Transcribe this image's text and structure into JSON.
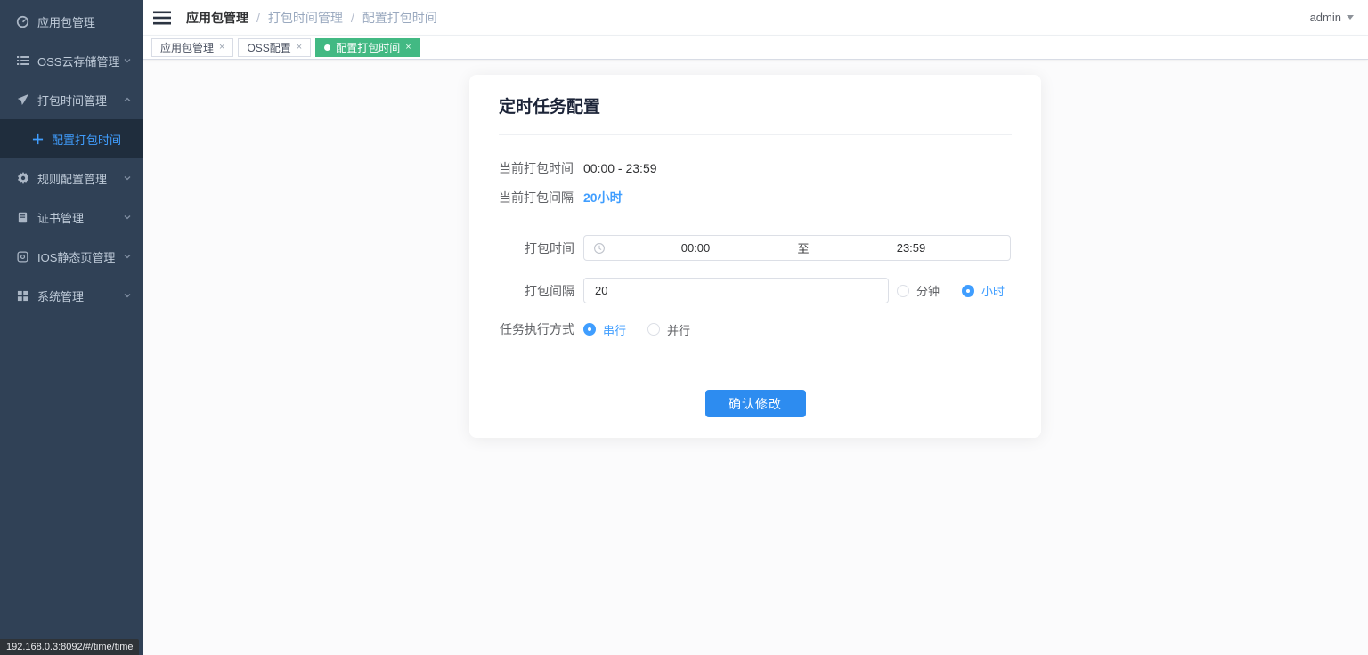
{
  "app": {
    "status_url": "192.168.0.3:8092/#/time/time"
  },
  "colors": {
    "accent_blue": "#409eff",
    "button_blue": "#2d8cf0",
    "tab_active_green": "#42b983",
    "sidebar_bg": "#304156",
    "sidebar_active_bg": "#1f2d3d"
  },
  "sidebar": {
    "items": [
      {
        "label": "应用包管理",
        "icon": "dashboard-icon",
        "has_chevron": false
      },
      {
        "label": "OSS云存储管理",
        "icon": "list-icon",
        "has_chevron": true,
        "expanded": false
      },
      {
        "label": "打包时间管理",
        "icon": "send-icon",
        "has_chevron": true,
        "expanded": true
      },
      {
        "label": "规则配置管理",
        "icon": "gear-icon",
        "has_chevron": true,
        "expanded": false
      },
      {
        "label": "证书管理",
        "icon": "certificate-icon",
        "has_chevron": true,
        "expanded": false
      },
      {
        "label": "IOS静态页管理",
        "icon": "ios-page-icon",
        "has_chevron": true,
        "expanded": false
      },
      {
        "label": "系统管理",
        "icon": "grid-icon",
        "has_chevron": true,
        "expanded": false
      }
    ],
    "active_subitem": {
      "label": "配置打包时间",
      "icon": "plus-icon",
      "active": true
    }
  },
  "header": {
    "breadcrumb": [
      "应用包管理",
      "打包时间管理",
      "配置打包时间"
    ],
    "breadcrumb_separator": "/",
    "user_menu": "admin"
  },
  "tabs": [
    {
      "label": "应用包管理",
      "close": "×",
      "active": false
    },
    {
      "label": "OSS配置",
      "close": "×",
      "active": false
    },
    {
      "label": "配置打包时间",
      "close": "×",
      "active": true
    }
  ],
  "form": {
    "title": "定时任务配置",
    "info": [
      {
        "label": "当前打包时间",
        "value": "00:00 - 23:59"
      },
      {
        "label": "当前打包间隔",
        "value": "20小时"
      }
    ],
    "pack_time": {
      "label": "打包时间",
      "start": "00:00",
      "separator": "至",
      "end": "23:59"
    },
    "interval": {
      "label": "打包间隔",
      "value": "20",
      "options": [
        {
          "label": "分钟",
          "checked": false
        },
        {
          "label": "小时",
          "checked": true
        }
      ]
    },
    "exec_mode": {
      "label": "任务执行方式",
      "options": [
        {
          "label": "串行",
          "checked": true
        },
        {
          "label": "并行",
          "checked": false
        }
      ]
    },
    "submit_label": "确认修改"
  }
}
